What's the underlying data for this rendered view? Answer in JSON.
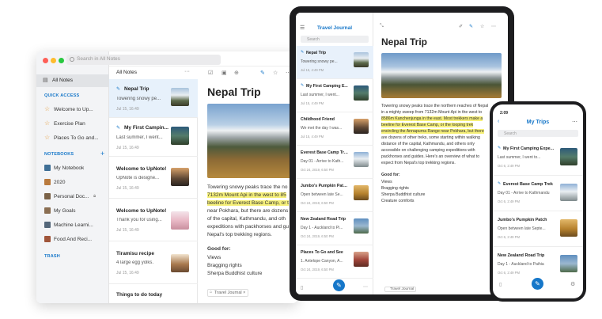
{
  "desktop": {
    "search_placeholder": "Search in All Notes",
    "sidebar": {
      "all_notes": "All Notes",
      "quick_access_label": "QUICK ACCESS",
      "quick_access": [
        "Welcome to Up...",
        "Exercise Plan",
        "Places To Go and..."
      ],
      "notebooks_label": "NOTEBOOKS",
      "notebooks_add": "+",
      "notebooks": [
        "My Notebook",
        "2020",
        "Personal Doc...",
        "My Goals",
        "Machine Learni...",
        "Food And Reci..."
      ],
      "trash_label": "TRASH"
    },
    "list_header": "All Notes",
    "list_more": "···",
    "notes": [
      {
        "title": "Nepal Trip",
        "preview": "Towering snowy pe...",
        "date": "Jul 15, 16:49",
        "pinned": true
      },
      {
        "title": "My First Campin...",
        "preview": "Last summer, I went...",
        "date": "Jul 15, 16:49",
        "pinned": true
      },
      {
        "title": "Welcome to UpNote!",
        "preview": "UpNote is designe...",
        "date": "Jul 15, 16:49",
        "pinned": false
      },
      {
        "title": "Welcome to UpNote!",
        "preview": "Thank you for using...",
        "date": "Jul 15, 16:49",
        "pinned": false
      },
      {
        "title": "Tiramisu recipe",
        "preview": "4 large egg yolks.",
        "date": "Jul 15, 16:49",
        "pinned": false
      },
      {
        "title": "Things to do today",
        "preview": "",
        "date": "",
        "pinned": false
      }
    ],
    "editor": {
      "title": "Nepal Trip",
      "body_lines": [
        "Towering snowy peaks trace the no",
        "7132m Mount Api in the west to 85",
        "beeline for Everest Base Camp, or t",
        "near Pokhara, but there are dozens",
        "of the capital, Kathmandu, and oth",
        "expeditions with packhorses and gu",
        "Nepal's top trekking regions."
      ],
      "good_for": "Good for:",
      "good_items": [
        "Views",
        "Bragging rights",
        "Sherpa Buddhist culture"
      ],
      "tag": "Travel Journal"
    }
  },
  "tablet": {
    "list_title": "Travel Journal",
    "search_placeholder": "Search",
    "notes": [
      {
        "title": "Nepal Trip",
        "preview": "Towering snowy pe...",
        "date": "Jul 15, 4:49 PM",
        "pinned": true
      },
      {
        "title": "My First Camping E...",
        "preview": "Last summer, I went...",
        "date": "Jul 15, 4:49 PM",
        "pinned": true
      },
      {
        "title": "Childhood Friend",
        "preview": "We met the day I was...",
        "date": "Jul 15, 4:49 PM",
        "pinned": false
      },
      {
        "title": "Everest Base Camp Trek",
        "preview": "Day 01 - Arrive to Kath...",
        "date": "Oct 24, 2019, 6:50 PM",
        "pinned": false
      },
      {
        "title": "Jumbo's Pumpkin Patch",
        "preview": "Open between late Se...",
        "date": "Oct 24, 2019, 6:50 PM",
        "pinned": false
      },
      {
        "title": "New Zealand Road Trip",
        "preview": "Day 1 - Auckland to Pi...",
        "date": "Oct 24, 2019, 6:50 PM",
        "pinned": false
      },
      {
        "title": "Places To Go and See",
        "preview": "1. Antelope Canyon, A...",
        "date": "Oct 24, 2019, 6:50 PM",
        "pinned": false
      }
    ],
    "editor": {
      "title": "Nepal Trip",
      "body_lines": [
        "Towering snowy peaks trace the northern reaches of Nepal",
        "in a mighty sweep from 7132m Mount Api in the west to",
        "8586m Kanchenjunga in the east. Most trekkers make a",
        "beeline for Everest Base Camp, or the looping trek",
        "encircling the Annapurna Range near Pokhara, but there",
        "are dozens of other treks, some starting within walking",
        "distance of the capital, Kathmandu, and others only",
        "accessible on challenging camping expeditions with",
        "packhorses and guides. Here's an overview of what to",
        "expect from Nepal's top trekking regions."
      ],
      "good_for": "Good for:",
      "good_items": [
        "Views",
        "Bragging rights",
        "Sherpa Buddhist culture",
        "Creature comforts"
      ],
      "tag": "Travel Journal"
    }
  },
  "phone": {
    "time": "2:09",
    "title": "My Trips",
    "search_placeholder": "Search",
    "notes": [
      {
        "title": "My First Camping Expe...",
        "preview": "Last summer, I went to...",
        "date": "Oct 6, 2:49 PM",
        "pinned": true
      },
      {
        "title": "Everest Base Camp Trek",
        "preview": "Day 01 - Arrive to Kathmandu",
        "date": "Oct 6, 2:49 PM",
        "pinned": true
      },
      {
        "title": "Jumbo's Pumpkin Patch",
        "preview": "Open between late Septe...",
        "date": "Oct 6, 2:49 PM",
        "pinned": false
      },
      {
        "title": "New Zealand Road Trip",
        "preview": "Day 1 - Auckland to Paihia",
        "date": "Oct 6, 2:49 PM",
        "pinned": false
      }
    ]
  },
  "colors": {
    "accent": "#1677c9",
    "highlight": "#f6f07a"
  },
  "icons": [
    "search-icon",
    "star-icon",
    "pin-icon",
    "plus-icon",
    "pen-icon",
    "more-icon",
    "lock-icon"
  ]
}
